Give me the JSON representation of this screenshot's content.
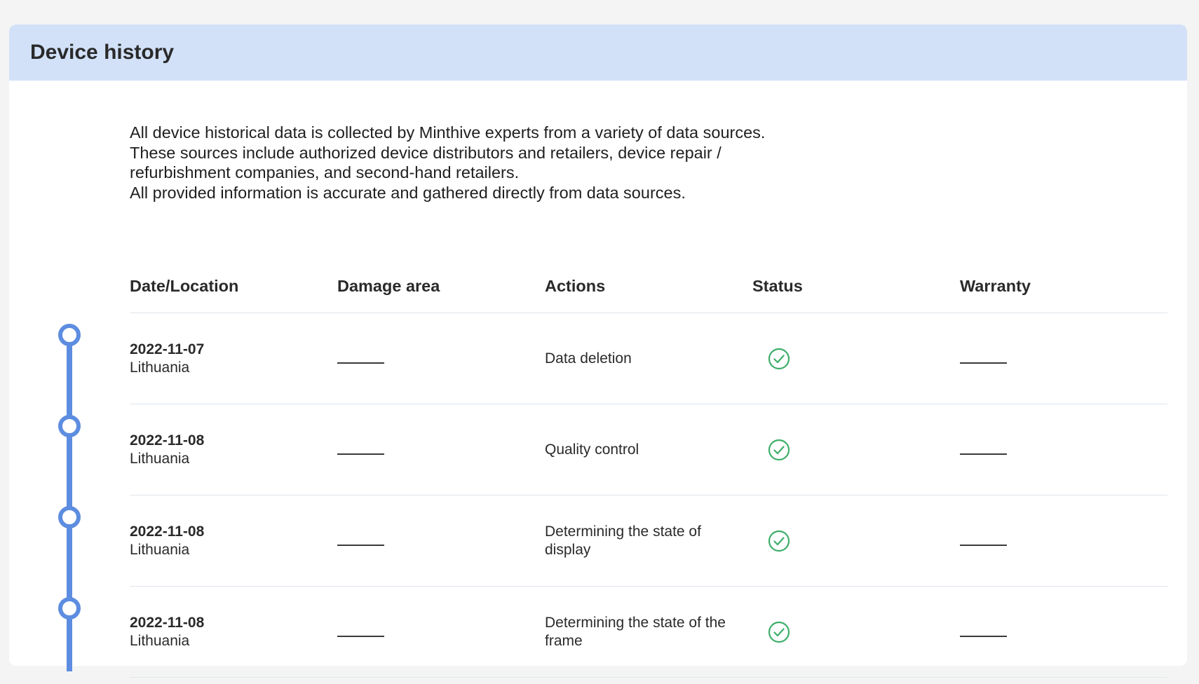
{
  "section": {
    "title": "Device history"
  },
  "intro": {
    "paragraph1": "All device historical data is collected by Minthive experts from a variety of data sources. These sources include authorized device distributors and retailers, device repair / refurbishment companies, and second-hand retailers.",
    "paragraph2": "All provided information is accurate and gathered directly from data sources."
  },
  "table": {
    "columns": [
      "Date/Location",
      "Damage area",
      "Actions",
      "Status",
      "Warranty"
    ],
    "rows": [
      {
        "date": "2022-11-07",
        "location": "Lithuania",
        "damage_area": "",
        "action": "Data deletion",
        "status": "check-circle-icon",
        "warranty": ""
      },
      {
        "date": "2022-11-08",
        "location": "Lithuania",
        "damage_area": "",
        "action": "Quality control",
        "status": "check-circle-icon",
        "warranty": ""
      },
      {
        "date": "2022-11-08",
        "location": "Lithuania",
        "damage_area": "",
        "action": "Determining the state of display",
        "status": "check-circle-icon",
        "warranty": ""
      },
      {
        "date": "2022-11-08",
        "location": "Lithuania",
        "damage_area": "",
        "action": "Determining the state of the frame",
        "status": "check-circle-icon",
        "warranty": ""
      }
    ]
  },
  "colors": {
    "header_bg": "#d2e1f8",
    "timeline": "#5d8de0",
    "status_ok": "#3fae6a",
    "page_bg": "#f4f4f4"
  }
}
